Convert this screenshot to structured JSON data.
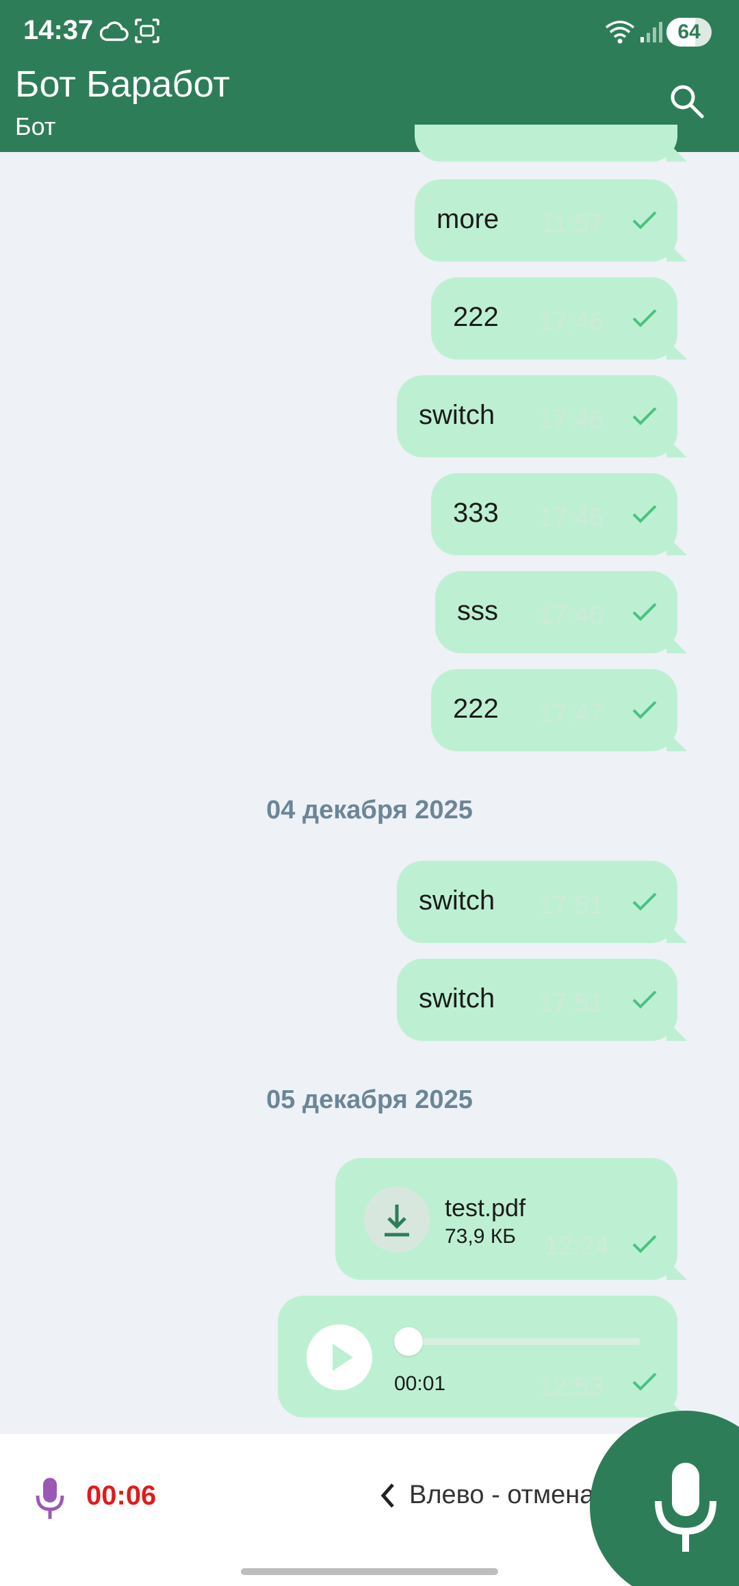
{
  "status_bar": {
    "time": "14:37",
    "battery": "64",
    "battery_level": 0.64
  },
  "header": {
    "title": "Бот Баработ",
    "subtitle": "Бот"
  },
  "messages_group1": [
    {
      "text": "more",
      "time": "11:57"
    },
    {
      "text": "222",
      "time": "17:46"
    },
    {
      "text": "switch",
      "time": "17:46"
    },
    {
      "text": "333",
      "time": "17:46"
    },
    {
      "text": "sss",
      "time": "17:46"
    },
    {
      "text": "222",
      "time": "17:47"
    }
  ],
  "date_sep_1": "04 декабря 2025",
  "messages_group2": [
    {
      "text": "switch",
      "time": "17:51"
    },
    {
      "text": "switch",
      "time": "17:51"
    }
  ],
  "date_sep_2": "05 декабря 2025",
  "file_message": {
    "name": "test.pdf",
    "size": "73,9 КБ",
    "time": "12:24"
  },
  "voice_message": {
    "duration": "00:01",
    "time": "12:53",
    "progress": 0.0
  },
  "recording": {
    "elapsed": "00:06",
    "cancel_hint": "Влево - отмена"
  },
  "colors": {
    "accent": "#2e7d59",
    "bubble": "#bdf0d2",
    "record": "#e01b1b"
  }
}
